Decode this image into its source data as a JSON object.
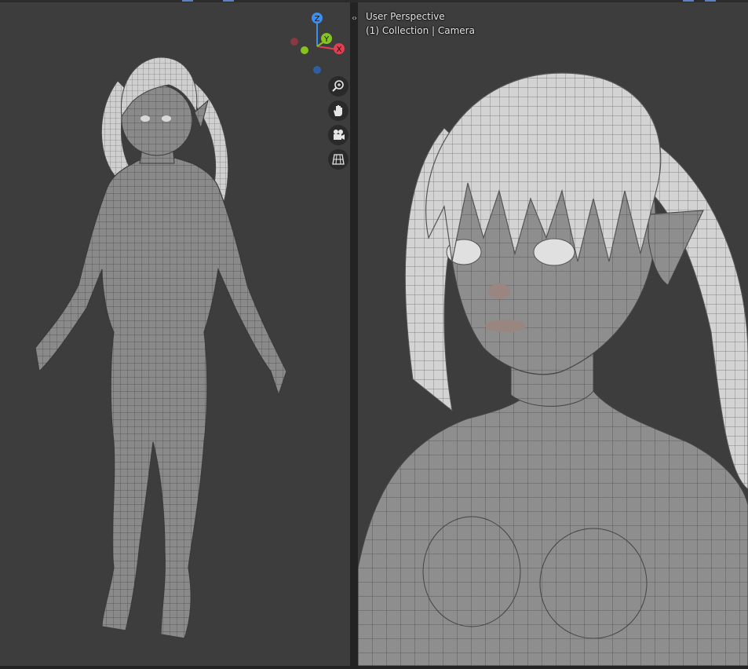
{
  "viewport_right": {
    "perspective_label": "User Perspective",
    "collection_label": "(1) Collection | Camera"
  },
  "gizmo": {
    "z_label": "Z",
    "y_label": "Y",
    "x_label": "X",
    "colors": {
      "x": "#e04050",
      "y": "#84c41c",
      "z": "#3b8ff0"
    }
  },
  "nav_tools": [
    "zoom-icon",
    "hand-pan-icon",
    "camera-icon",
    "ortho-grid-icon"
  ],
  "colors": {
    "viewport_bg": "#3d3d3d",
    "mesh_surface": "#8d8d8d",
    "hair_surface": "#d2d2d2",
    "splitter": "#232323"
  }
}
